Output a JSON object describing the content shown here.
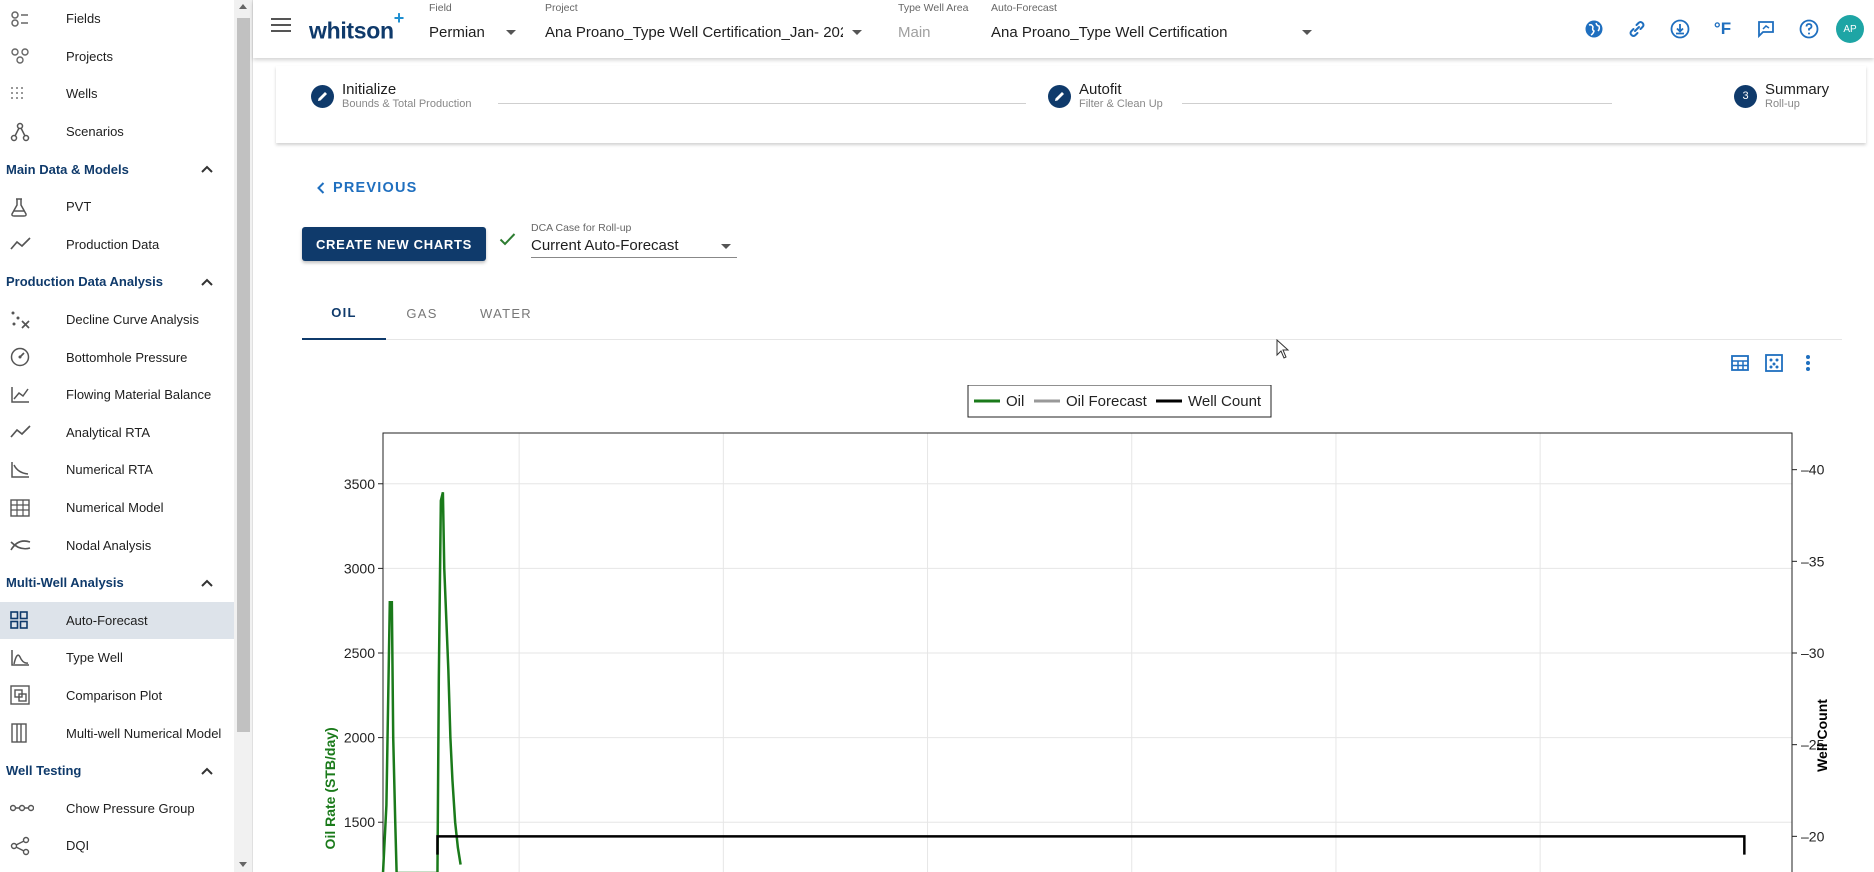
{
  "sidebar": {
    "items_top": [
      {
        "label": "Fields",
        "icon": "fields-icon"
      },
      {
        "label": "Projects",
        "icon": "projects-icon"
      },
      {
        "label": "Wells",
        "icon": "wells-icon"
      },
      {
        "label": "Scenarios",
        "icon": "scenarios-icon"
      }
    ],
    "sections": [
      {
        "title": "Main Data & Models",
        "items": [
          {
            "label": "PVT",
            "icon": "flask-icon"
          },
          {
            "label": "Production Data",
            "icon": "trend-icon"
          }
        ]
      },
      {
        "title": "Production Data Analysis",
        "items": [
          {
            "label": "Decline Curve Analysis",
            "icon": "decline-icon"
          },
          {
            "label": "Bottomhole Pressure",
            "icon": "gauge-icon"
          },
          {
            "label": "Flowing Material Balance",
            "icon": "chart-lines-icon"
          },
          {
            "label": "Analytical RTA",
            "icon": "trend-icon"
          },
          {
            "label": "Numerical RTA",
            "icon": "chart-decline-icon"
          },
          {
            "label": "Numerical Model",
            "icon": "grid-model-icon"
          },
          {
            "label": "Nodal Analysis",
            "icon": "nodal-icon"
          }
        ]
      },
      {
        "title": "Multi-Well Analysis",
        "items": [
          {
            "label": "Auto-Forecast",
            "icon": "dashboard-icon",
            "active": true
          },
          {
            "label": "Type Well",
            "icon": "curve-icon"
          },
          {
            "label": "Comparison Plot",
            "icon": "compare-icon"
          },
          {
            "label": "Multi-well Numerical Model",
            "icon": "columns-icon"
          }
        ]
      },
      {
        "title": "Well Testing",
        "items": [
          {
            "label": "Chow Pressure Group",
            "icon": "chain-icon"
          },
          {
            "label": "DQI",
            "icon": "share-icon"
          }
        ]
      }
    ]
  },
  "topbar": {
    "logo": "whitson",
    "logo_plus": "+",
    "field": {
      "caption": "Field",
      "value": "Permian"
    },
    "project": {
      "caption": "Project",
      "value": "Ana Proano_Type Well Certification_Jan- 202"
    },
    "type_well_area": {
      "caption": "Type Well Area",
      "value": "Main"
    },
    "auto_forecast": {
      "caption": "Auto-Forecast",
      "value": "Ana Proano_Type Well Certification"
    },
    "temp_unit": "°F",
    "avatar": "AP"
  },
  "stepper": {
    "steps": [
      {
        "title": "Initialize",
        "subtitle": "Bounds & Total Production"
      },
      {
        "title": "Autofit",
        "subtitle": "Filter & Clean Up"
      },
      {
        "title": "Summary",
        "subtitle": "Roll-up",
        "number": "3"
      }
    ]
  },
  "actions": {
    "previous": "PREVIOUS",
    "create_charts": "CREATE NEW CHARTS",
    "dca_caption": "DCA Case for Roll-up",
    "dca_value": "Current Auto-Forecast"
  },
  "tabs": [
    "OIL",
    "GAS",
    "WATER"
  ],
  "colors": {
    "primary": "#0f3a6b",
    "accent": "#1f6fbf",
    "oil": "#1a7a1a",
    "forecast": "#999999",
    "well_count": "#000000"
  },
  "chart_data": {
    "type": "line",
    "legend": [
      "Oil",
      "Oil Forecast",
      "Well Count"
    ],
    "legend_position": "top-center",
    "ylabel": "Oil Rate (STB/day)",
    "y2label": "Well Count",
    "yticks": [
      1500,
      2000,
      2500,
      3000,
      3500
    ],
    "y2ticks": [
      20,
      25,
      30,
      35,
      40
    ],
    "grid": true,
    "series": [
      {
        "name": "Oil",
        "points": [
          [
            0.0,
            1200
          ],
          [
            0.5,
            1600
          ],
          [
            1.0,
            2800
          ],
          [
            1.3,
            2800
          ],
          [
            1.5,
            2000
          ],
          [
            1.8,
            1500
          ],
          [
            2.0,
            1200
          ],
          [
            8.0,
            1200
          ],
          [
            8.2,
            2350
          ],
          [
            8.5,
            3400
          ],
          [
            8.8,
            3450
          ],
          [
            9.0,
            3000
          ],
          [
            9.3,
            2700
          ],
          [
            9.6,
            2400
          ],
          [
            9.9,
            2000
          ],
          [
            10.2,
            1750
          ],
          [
            10.6,
            1500
          ],
          [
            11.0,
            1350
          ],
          [
            11.4,
            1250
          ]
        ]
      },
      {
        "name": "Well Count",
        "points": [
          [
            8.0,
            19
          ],
          [
            8.0,
            20
          ],
          [
            200.0,
            20
          ],
          [
            200.0,
            19
          ]
        ]
      }
    ],
    "x_range": [
      0,
      207
    ],
    "y_range": [
      1200,
      3800
    ],
    "y2_range": [
      18,
      42
    ]
  }
}
